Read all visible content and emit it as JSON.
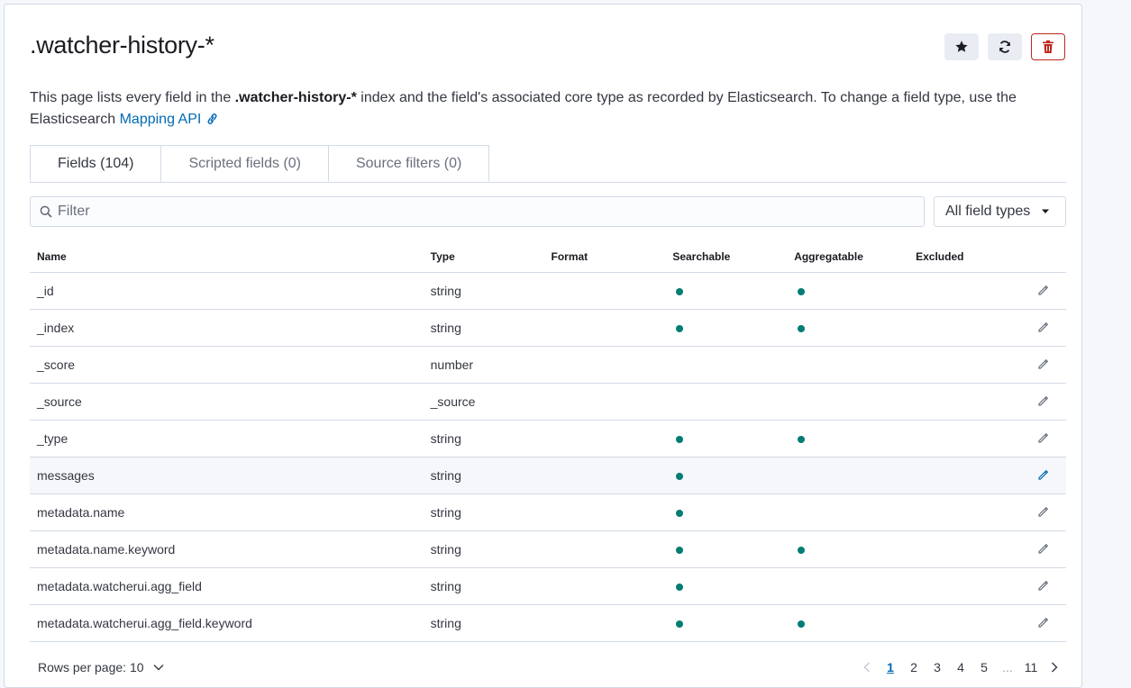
{
  "page": {
    "title": ".watcher-history-*",
    "description_prefix": "This page lists every field in the ",
    "description_index": ".watcher-history-*",
    "description_suffix": " index and the field's associated core type as recorded by Elasticsearch. To change a field type, use the Elasticsearch ",
    "mapping_link": "Mapping API"
  },
  "actions": {
    "favorite_icon": "star-icon",
    "refresh_icon": "refresh-icon",
    "delete_icon": "trash-icon",
    "delete_color": "#bd271e"
  },
  "tabs": [
    {
      "label": "Fields (104)",
      "active": true
    },
    {
      "label": "Scripted fields (0)",
      "active": false
    },
    {
      "label": "Source filters (0)",
      "active": false
    }
  ],
  "filter": {
    "placeholder": "Filter",
    "type_select": "All field types"
  },
  "table": {
    "columns": [
      "Name",
      "Type",
      "Format",
      "Searchable",
      "Aggregatable",
      "Excluded"
    ],
    "rows": [
      {
        "name": "_id",
        "type": "string",
        "searchable": true,
        "aggregatable": true
      },
      {
        "name": "_index",
        "type": "string",
        "searchable": true,
        "aggregatable": true
      },
      {
        "name": "_score",
        "type": "number",
        "searchable": false,
        "aggregatable": false
      },
      {
        "name": "_source",
        "type": "_source",
        "searchable": false,
        "aggregatable": false
      },
      {
        "name": "_type",
        "type": "string",
        "searchable": true,
        "aggregatable": true
      },
      {
        "name": "messages",
        "type": "string",
        "searchable": true,
        "aggregatable": false
      },
      {
        "name": "metadata.name",
        "type": "string",
        "searchable": true,
        "aggregatable": false
      },
      {
        "name": "metadata.name.keyword",
        "type": "string",
        "searchable": true,
        "aggregatable": true
      },
      {
        "name": "metadata.watcherui.agg_field",
        "type": "string",
        "searchable": true,
        "aggregatable": false
      },
      {
        "name": "metadata.watcherui.agg_field.keyword",
        "type": "string",
        "searchable": true,
        "aggregatable": true
      }
    ]
  },
  "footer": {
    "rows_per_page": "Rows per page: 10",
    "pages": [
      "1",
      "2",
      "3",
      "4",
      "5",
      "...",
      "11"
    ],
    "current_page": "1"
  },
  "colors": {
    "accent": "#006bb4",
    "indicator": "#017d73"
  }
}
